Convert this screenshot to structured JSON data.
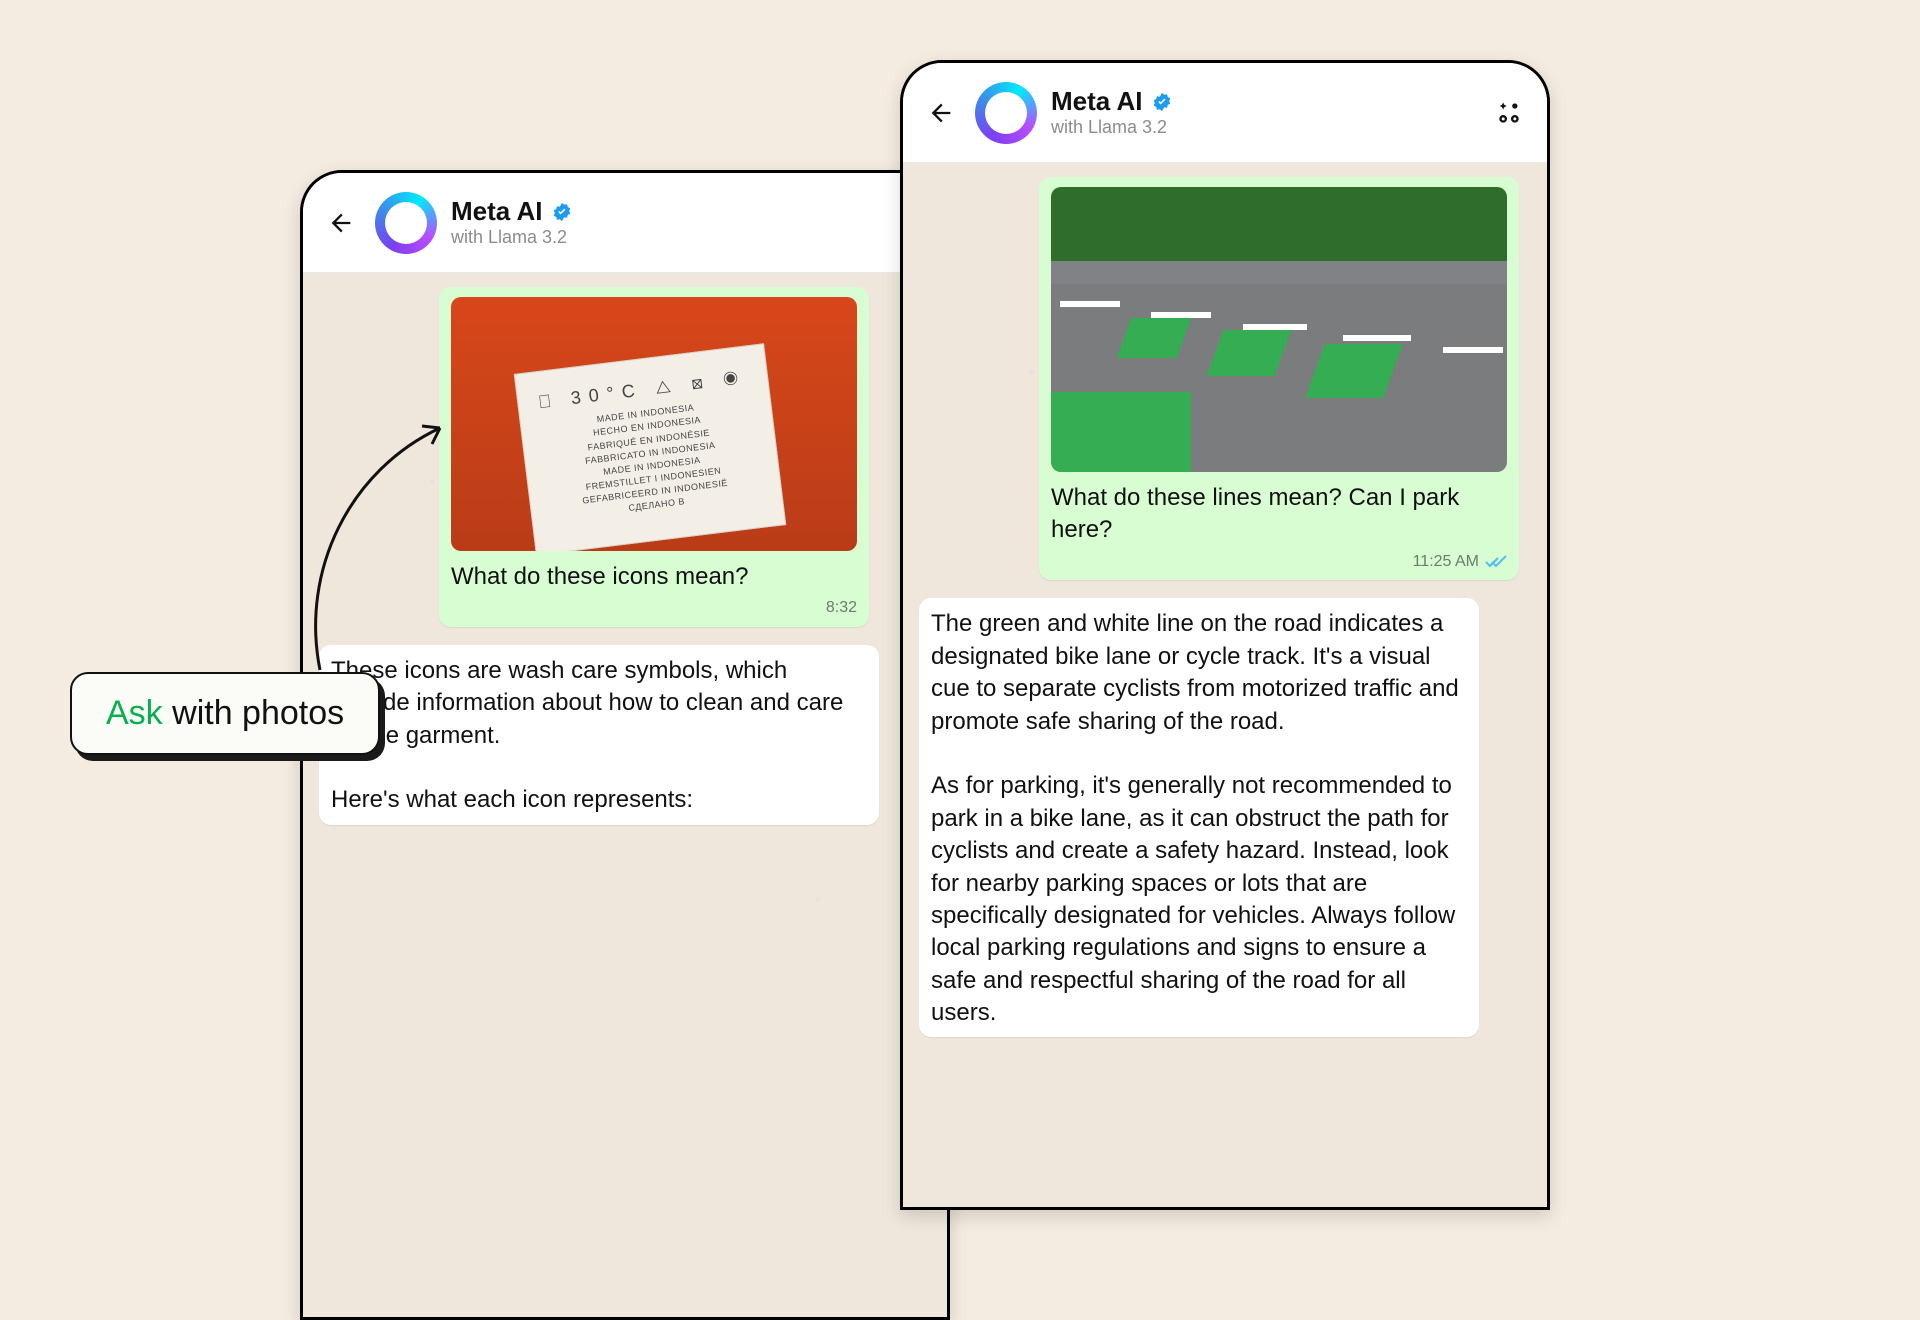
{
  "callout": {
    "accent": "Ask",
    "rest": " with photos"
  },
  "header": {
    "title": "Meta AI",
    "subtitle": "with Llama 3.2"
  },
  "phone_left": {
    "sent": {
      "caption": "What do these icons mean?",
      "time": "8:32",
      "image_alt": "clothing-care-label",
      "label_symbols": "⎕ 30°C  △  ⊠  ◉",
      "label_lines": [
        "MADE IN INDONESIA",
        "HECHO EN INDONESIA",
        "FABRIQUÉ EN INDONÉSIE",
        "FABBRICATO IN INDONESIA",
        "MADE IN INDONESIA",
        "FREMSTILLET I INDONESIEN",
        "GEFABRICEERD IN INDONESIË",
        "СДЕЛАНО В"
      ]
    },
    "recv": {
      "text": "These icons are wash care symbols, which provide information about how to clean and care for the garment.\n\nHere's what each icon represents:"
    }
  },
  "phone_right": {
    "sent": {
      "caption": "What do these lines mean? Can I park here?",
      "time": "11:25 AM",
      "image_alt": "road-bike-lane"
    },
    "recv": {
      "text": "The green and white line on the road indicates a designated bike lane or cycle track. It's a visual cue to separate cyclists from motorized traffic and promote safe sharing of the road.\n\nAs for parking, it's generally not recommended to park in a bike lane, as it can obstruct the path for cyclists and create a safety hazard. Instead, look for nearby parking spaces or lots that are specifically designated for vehicles. Always follow local parking regulations and signs to ensure a safe and respectful sharing of the road for all users."
    }
  }
}
